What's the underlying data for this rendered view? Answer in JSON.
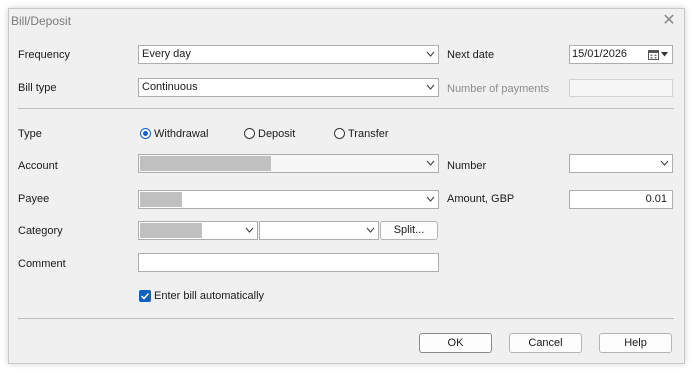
{
  "window": {
    "title": "Bill/Deposit",
    "close_glyph": "✕"
  },
  "frequency": {
    "label": "Frequency",
    "value": "Every day"
  },
  "next_date": {
    "label": "Next date",
    "value": "15/01/2026"
  },
  "bill_type": {
    "label": "Bill type",
    "value": "Continuous"
  },
  "number_of_payments": {
    "label": "Number of payments",
    "value": ""
  },
  "type": {
    "label": "Type",
    "options": [
      {
        "label": "Withdrawal",
        "checked": true
      },
      {
        "label": "Deposit",
        "checked": false
      },
      {
        "label": "Transfer",
        "checked": false
      }
    ]
  },
  "account": {
    "label": "Account",
    "value": ""
  },
  "number": {
    "label": "Number",
    "value": ""
  },
  "payee": {
    "label": "Payee",
    "value": ""
  },
  "amount": {
    "label": "Amount, GBP",
    "value": "0.01"
  },
  "category": {
    "label": "Category",
    "value": "",
    "subcategory": "",
    "split_label": "Split..."
  },
  "comment": {
    "label": "Comment",
    "value": ""
  },
  "enter_auto": {
    "label": "Enter bill automatically",
    "checked": true
  },
  "buttons": {
    "ok": "OK",
    "cancel": "Cancel",
    "help": "Help"
  },
  "colors": {
    "accent": "#0f60c4",
    "redacted": "#c0c0c0"
  },
  "icons": {
    "calendar": "calendar-icon",
    "dropdown": "chevron-down-icon",
    "check": "checkmark-icon"
  }
}
